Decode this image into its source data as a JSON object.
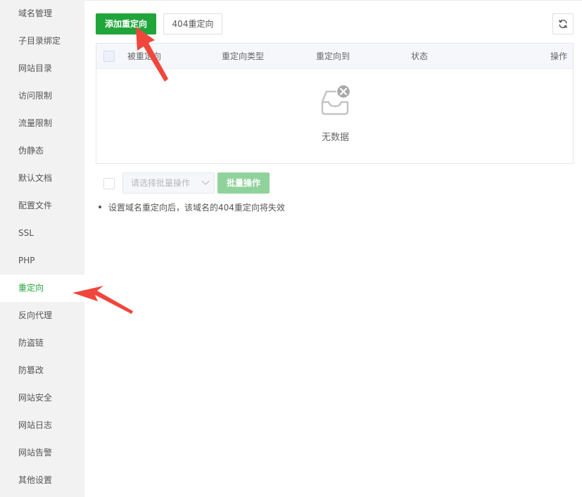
{
  "sidebar": {
    "items": [
      {
        "label": "域名管理"
      },
      {
        "label": "子目录绑定"
      },
      {
        "label": "网站目录"
      },
      {
        "label": "访问限制"
      },
      {
        "label": "流量限制"
      },
      {
        "label": "伪静态"
      },
      {
        "label": "默认文档"
      },
      {
        "label": "配置文件"
      },
      {
        "label": "SSL"
      },
      {
        "label": "PHP"
      },
      {
        "label": "重定向",
        "active": true
      },
      {
        "label": "反向代理"
      },
      {
        "label": "防盗链"
      },
      {
        "label": "防篡改"
      },
      {
        "label": "网站安全"
      },
      {
        "label": "网站日志"
      },
      {
        "label": "网站告警"
      },
      {
        "label": "其他设置"
      }
    ]
  },
  "toolbar": {
    "add_label": "添加重定向",
    "redirect404_label": "404重定向",
    "refresh_icon": "refresh-icon"
  },
  "table": {
    "columns": [
      "被重定向",
      "重定向类型",
      "重定向到",
      "状态",
      "操作"
    ],
    "rows": [],
    "empty_text": "无数据",
    "empty_icon": "empty-inbox-icon"
  },
  "batch": {
    "select_placeholder": "请选择批量操作",
    "button_label": "批量操作"
  },
  "tip": "设置域名重定向后，该域名的404重定向将失效",
  "colors": {
    "accent": "#20a53a",
    "accent_disabled": "#90d29c",
    "annotation_arrow": "#f0463c"
  }
}
